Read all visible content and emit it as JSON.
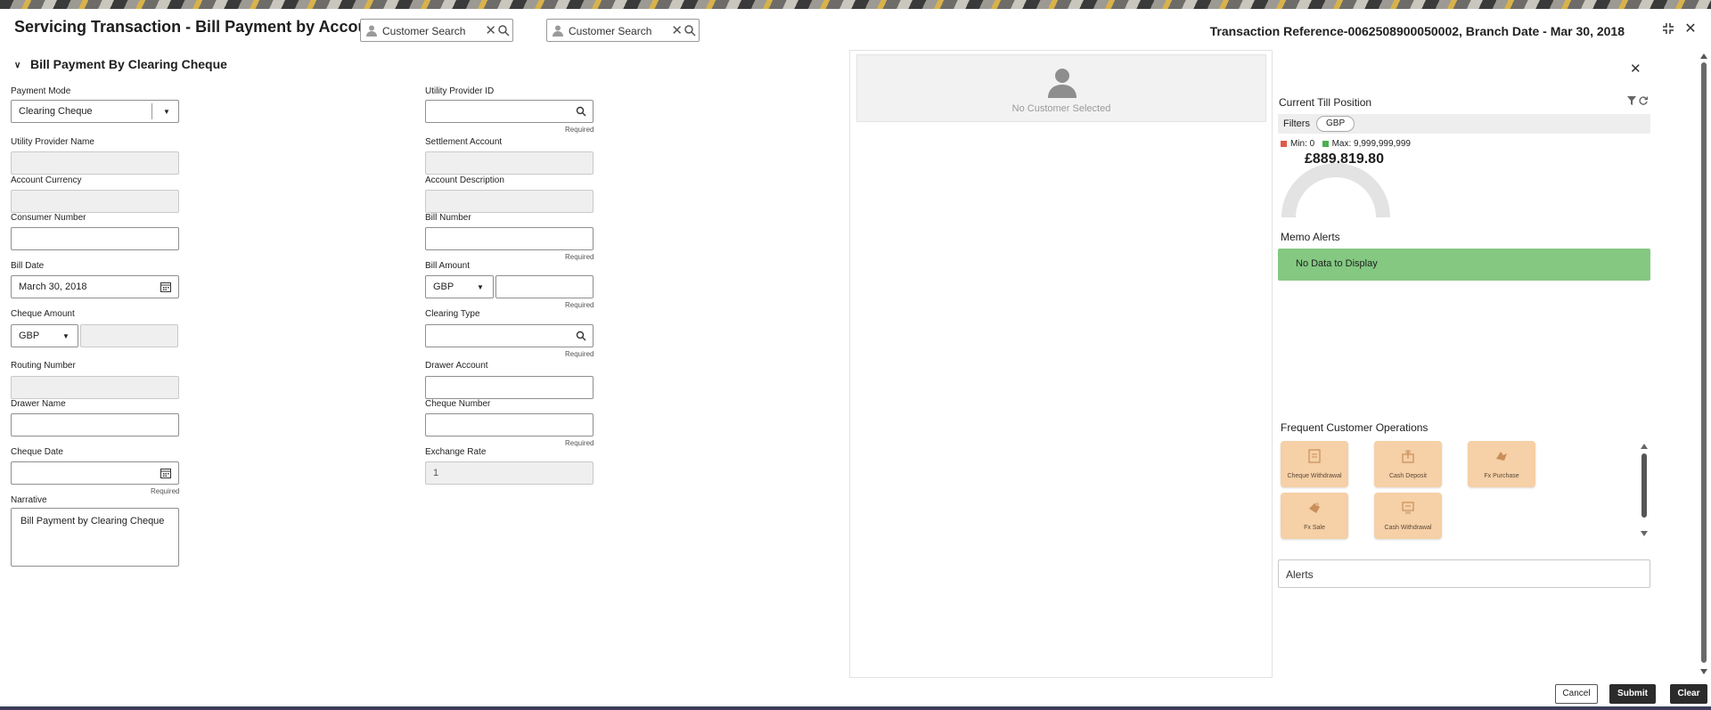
{
  "header": {
    "title": "Servicing Transaction - Bill Payment by Account",
    "search1_placeholder": "Customer Search",
    "search2_placeholder": "Customer Search",
    "transaction_info": "Transaction Reference-0062508900050002, Branch Date - Mar 30, 2018",
    "icons": [
      "minimize-icon",
      "close-icon"
    ]
  },
  "form": {
    "section_title": "Bill Payment By Clearing Cheque",
    "payment_mode": {
      "label": "Payment Mode",
      "value": "Clearing Cheque"
    },
    "utility_provider_id": {
      "label": "Utility Provider ID",
      "value": "",
      "required": "Required"
    },
    "utility_provider_name": {
      "label": "Utility Provider Name",
      "value": ""
    },
    "settlement_account": {
      "label": "Settlement Account",
      "value": ""
    },
    "account_currency": {
      "label": "Account Currency",
      "value": ""
    },
    "account_description": {
      "label": "Account Description",
      "value": ""
    },
    "consumer_number": {
      "label": "Consumer Number",
      "value": ""
    },
    "bill_number": {
      "label": "Bill Number",
      "value": "",
      "required": "Required"
    },
    "bill_date": {
      "label": "Bill Date",
      "value": "March 30, 2018"
    },
    "bill_amount": {
      "label": "Bill Amount",
      "currency": "GBP",
      "value": "",
      "required": "Required"
    },
    "cheque_amount": {
      "label": "Cheque Amount",
      "currency": "GBP",
      "value": ""
    },
    "clearing_type": {
      "label": "Clearing Type",
      "value": "",
      "required": "Required"
    },
    "routing_number": {
      "label": "Routing Number",
      "value": ""
    },
    "drawer_account": {
      "label": "Drawer Account",
      "value": ""
    },
    "drawer_name": {
      "label": "Drawer Name",
      "value": ""
    },
    "cheque_number": {
      "label": "Cheque Number",
      "value": "",
      "required": "Required"
    },
    "cheque_date": {
      "label": "Cheque Date",
      "value": "",
      "required": "Required"
    },
    "exchange_rate": {
      "label": "Exchange Rate",
      "value": "1"
    },
    "narrative": {
      "label": "Narrative",
      "value": "Bill Payment by Clearing Cheque"
    }
  },
  "customer_panel": {
    "empty_text": "No Customer Selected"
  },
  "till": {
    "heading": "Current Till Position",
    "filters_label": "Filters",
    "filter_chip": "GBP",
    "min_label": "Min: 0",
    "max_label": "Max: 9,999,999,999",
    "amount": "£889,819.80",
    "gauge_level": 0.0,
    "colors": {
      "min": "#e05a47",
      "max": "#4caf50",
      "gauge_track": "#e3e3e3"
    }
  },
  "memo": {
    "heading": "Memo Alerts",
    "empty_text": "No Data to Display",
    "color": "#84c882"
  },
  "frequent_ops": {
    "heading": "Frequent Customer Operations",
    "items": [
      {
        "label": "Cheque Withdrawal",
        "icon": "cheque-icon"
      },
      {
        "label": "Cash Deposit",
        "icon": "cash-deposit-icon"
      },
      {
        "label": "Fx Purchase",
        "icon": "fx-purchase-icon"
      },
      {
        "label": "Fx Sale",
        "icon": "fx-sale-icon"
      },
      {
        "label": "Cash Withdrawal",
        "icon": "cash-withdrawal-icon"
      }
    ],
    "tile_color": "#f6d0a6"
  },
  "alerts": {
    "label": "Alerts"
  },
  "actions": {
    "cancel": "Cancel",
    "submit": "Submit",
    "clear": "Clear"
  }
}
